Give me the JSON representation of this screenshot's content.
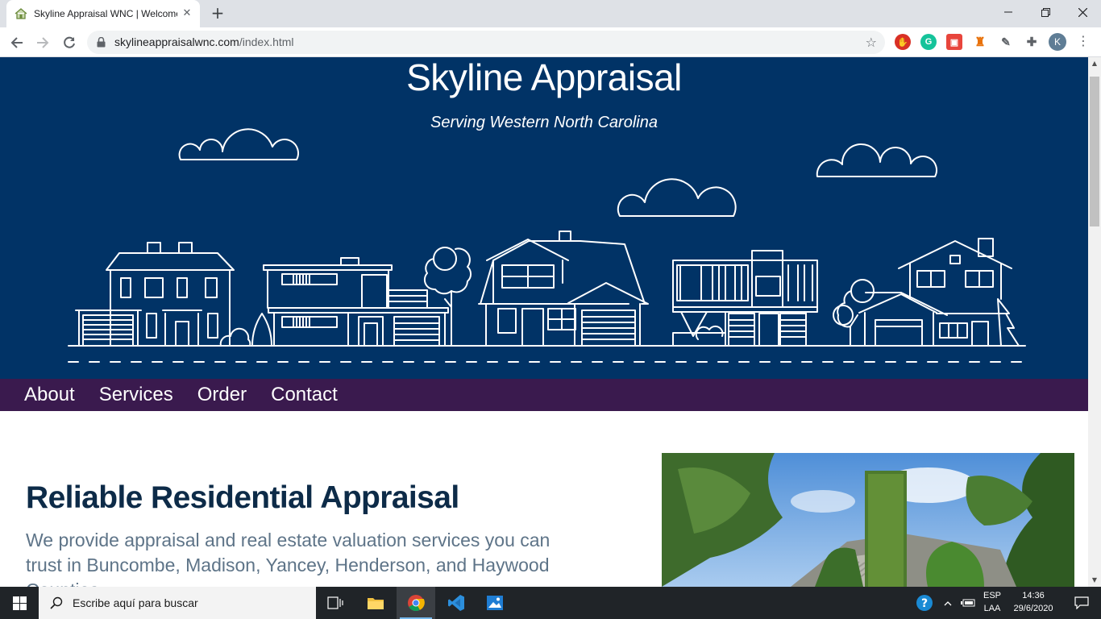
{
  "browser": {
    "tab_title": "Skyline Appraisal WNC | Welcome",
    "tab_close_icon": "close-icon",
    "new_tab_label": "+",
    "url_host": "skylineappraisalwnc.com",
    "url_path": "/index.html",
    "profile_initial": "K",
    "window_controls": [
      "minimize",
      "restore",
      "close"
    ]
  },
  "site": {
    "title": "Skyline Appraisal",
    "tagline": "Serving Western North Carolina",
    "nav": [
      "About",
      "Services",
      "Order",
      "Contact"
    ],
    "heading": "Reliable Residential Appraisal",
    "intro": "We provide appraisal and real estate valuation services you can trust in Buncombe, Madison, Yancey, Henderson, and Haywood Counties.",
    "colors": {
      "hero": "#013366",
      "nav": "#3a1a4e",
      "heading": "#0d2b48",
      "body_text": "#5e7488"
    }
  },
  "taskbar": {
    "search_placeholder": "Escribe aquí para buscar",
    "lang_top": "ESP",
    "lang_bottom": "LAA",
    "time": "14:36",
    "date": "29/6/2020"
  }
}
